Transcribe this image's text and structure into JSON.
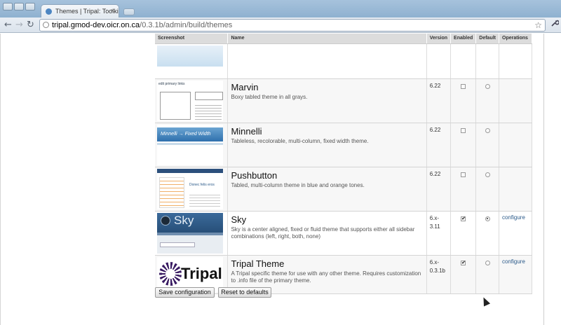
{
  "browser": {
    "tab_title": "Themes | Tripal: Toolki...",
    "tab_close": "×",
    "url_host": "tripal.gmod-dev.oicr.on.ca",
    "url_path": "/0.3.1b/admin/build/themes",
    "back_icon": "←",
    "forward_icon": "→",
    "reload_icon": "↻",
    "star_icon": "☆",
    "wrench_icon": "🔧"
  },
  "table": {
    "headers": {
      "screenshot": "Screenshot",
      "name": "Name",
      "version": "Version",
      "enabled": "Enabled",
      "default": "Default",
      "operations": "Operations"
    },
    "rows": [
      {
        "name": "Marvin",
        "description": "Boxy tabled theme in all grays.",
        "version": "6.22",
        "enabled": false,
        "default": false,
        "operation": "",
        "thumb_text": "edit primary links"
      },
      {
        "name": "Minnelli",
        "description": "Tableless, recolorable, multi-column, fixed width theme.",
        "version": "6.22",
        "enabled": false,
        "default": false,
        "operation": "",
        "thumb_text": "Minnelli → Fixed Width"
      },
      {
        "name": "Pushbutton",
        "description": "Tabled, multi-column theme in blue and orange tones.",
        "version": "6.22",
        "enabled": false,
        "default": false,
        "operation": "",
        "thumb_text": "Donec felis eros"
      },
      {
        "name": "Sky",
        "description": "Sky is a center aligned, fixed or fluid theme that supports either all sidebar combinations (left, right, both, none)",
        "version": "6.x-3.11",
        "enabled": true,
        "default": true,
        "operation": "configure",
        "thumb_text": "Sky"
      },
      {
        "name": "Tripal Theme",
        "description": "A Tripal specific theme for use with any other theme. Requires customization to .info file of the primary theme.",
        "version": "6.x-0.3.1b",
        "enabled": true,
        "default": false,
        "operation": "configure",
        "thumb_text": "Tripal"
      }
    ]
  },
  "buttons": {
    "save": "Save configuration",
    "reset": "Reset to defaults"
  },
  "checkmark": "✔",
  "colors": {
    "header_bg": "#dcdcdc",
    "link": "#2b5a8a",
    "chrome": "#a6c2dc"
  }
}
